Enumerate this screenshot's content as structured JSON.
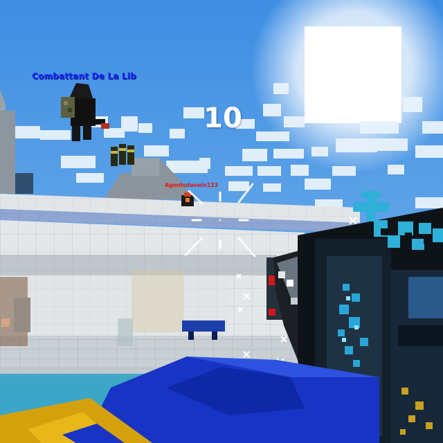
{
  "hud": {
    "countdown": "10",
    "crosshair_icon": "crosshair-icon"
  },
  "players": {
    "flying_player": {
      "name": "Combattant De La Lib",
      "name_color": "#1a2cff"
    },
    "enemy_player": {
      "name": "Agentsdaswin123",
      "name_color": "#e01818"
    }
  },
  "items": {
    "pickup_icon": "ammo-pickup-icon",
    "weapon_icon": "pixel-blaster-weapon-icon"
  },
  "colors": {
    "sky": "#5aa0e6",
    "sun": "#ffffff",
    "wall": "#d9dee2",
    "water_block": "#1030c0",
    "weapon_accent": "#29a6d8"
  }
}
